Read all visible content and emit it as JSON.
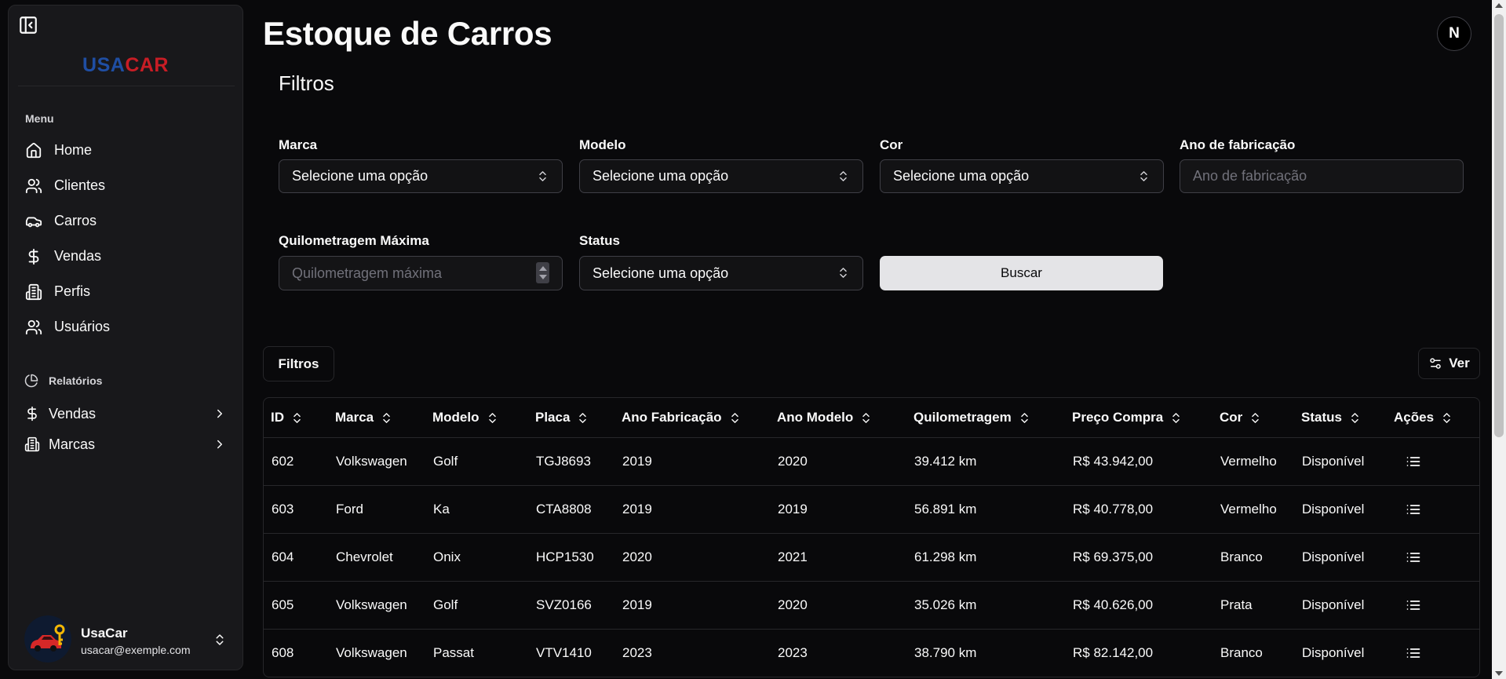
{
  "sidebar": {
    "logo": {
      "part1": "USA",
      "part2": "CAR"
    },
    "menu_label": "Menu",
    "menu_items": [
      {
        "label": "Home",
        "icon": "home-icon"
      },
      {
        "label": "Clientes",
        "icon": "users-icon"
      },
      {
        "label": "Carros",
        "icon": "car-icon"
      },
      {
        "label": "Vendas",
        "icon": "dollar-sign-icon"
      },
      {
        "label": "Perfis",
        "icon": "building-icon"
      },
      {
        "label": "Usuários",
        "icon": "users-icon"
      }
    ],
    "reports_label": "Relatórios",
    "reports_items": [
      {
        "label": "Vendas",
        "icon": "dollar-sign-icon"
      },
      {
        "label": "Marcas",
        "icon": "building-icon"
      }
    ],
    "user": {
      "name": "UsaCar",
      "email": "usacar@exemple.com"
    }
  },
  "header": {
    "title": "Estoque de Carros",
    "dev_badge": "N"
  },
  "filters": {
    "heading": "Filtros",
    "marca": {
      "label": "Marca",
      "value": "Selecione uma opção"
    },
    "modelo": {
      "label": "Modelo",
      "value": "Selecione uma opção"
    },
    "cor": {
      "label": "Cor",
      "value": "Selecione uma opção"
    },
    "ano_fabricacao": {
      "label": "Ano de fabricação",
      "placeholder": "Ano de fabricação"
    },
    "quilometragem": {
      "label": "Quilometragem Máxima",
      "placeholder": "Quilometragem máxima"
    },
    "status": {
      "label": "Status",
      "value": "Selecione uma opção"
    },
    "search_button": "Buscar"
  },
  "toolbar": {
    "filters_button": "Filtros",
    "view_button": "Ver"
  },
  "table": {
    "columns": [
      "ID",
      "Marca",
      "Modelo",
      "Placa",
      "Ano Fabricação",
      "Ano Modelo",
      "Quilometragem",
      "Preço Compra",
      "Cor",
      "Status",
      "Ações"
    ],
    "rows": [
      [
        "602",
        "Volkswagen",
        "Golf",
        "TGJ8693",
        "2019",
        "2020",
        "39.412 km",
        "R$ 43.942,00",
        "Vermelho",
        "Disponível"
      ],
      [
        "603",
        "Ford",
        "Ka",
        "CTA8808",
        "2019",
        "2019",
        "56.891 km",
        "R$ 40.778,00",
        "Vermelho",
        "Disponível"
      ],
      [
        "604",
        "Chevrolet",
        "Onix",
        "HCP1530",
        "2020",
        "2021",
        "61.298 km",
        "R$ 69.375,00",
        "Branco",
        "Disponível"
      ],
      [
        "605",
        "Volkswagen",
        "Golf",
        "SVZ0166",
        "2019",
        "2020",
        "35.026 km",
        "R$ 40.626,00",
        "Prata",
        "Disponível"
      ],
      [
        "608",
        "Volkswagen",
        "Passat",
        "VTV1410",
        "2023",
        "2023",
        "38.790 km",
        "R$ 82.142,00",
        "Branco",
        "Disponível"
      ]
    ]
  },
  "colors": {
    "background": "#09090b",
    "sidebar": "#18181b",
    "border": "#27272a",
    "brand_blue": "#1f4ea3",
    "brand_red": "#c81d25",
    "primary_button": "#e4e4e7"
  }
}
